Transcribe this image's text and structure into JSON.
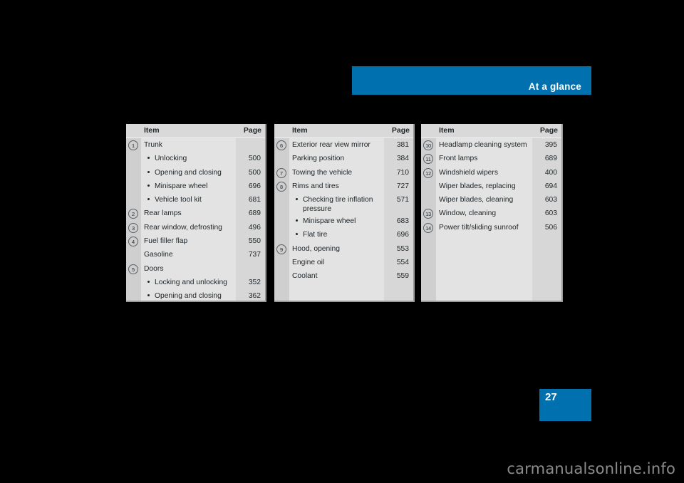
{
  "header": {
    "title": "At a glance",
    "bar_color": "#0070ae"
  },
  "page_number": {
    "value": "27",
    "block_color": "#0070ae"
  },
  "watermark": {
    "text": "carmanualsonline.info",
    "color": "#8c8c8c"
  },
  "columns": {
    "item": "Item",
    "page": "Page"
  },
  "tables": [
    {
      "id": "table-1",
      "rows": [
        {
          "num": "1",
          "label": "Trunk",
          "page": "",
          "type": "main"
        },
        {
          "num": "",
          "label": "Unlocking",
          "page": "500",
          "type": "bullet"
        },
        {
          "num": "",
          "label": "Opening and closing",
          "page": "500",
          "type": "bullet"
        },
        {
          "num": "",
          "label": "Minispare wheel",
          "page": "696",
          "type": "bullet"
        },
        {
          "num": "",
          "label": "Vehicle tool kit",
          "page": "681",
          "type": "bullet"
        },
        {
          "num": "2",
          "label": "Rear lamps",
          "page": "689",
          "type": "main"
        },
        {
          "num": "3",
          "label": "Rear window, defrosting",
          "page": "496",
          "type": "main"
        },
        {
          "num": "4",
          "label": "Fuel filler flap",
          "page": "550",
          "type": "main"
        },
        {
          "num": "",
          "label": "Gasoline",
          "page": "737",
          "type": "plain"
        },
        {
          "num": "5",
          "label": "Doors",
          "page": "",
          "type": "main"
        },
        {
          "num": "",
          "label": "Locking and unlocking",
          "page": "352",
          "type": "bullet"
        },
        {
          "num": "",
          "label": "Opening and closing",
          "page": "362",
          "type": "bullet"
        }
      ]
    },
    {
      "id": "table-2",
      "rows": [
        {
          "num": "6",
          "label": "Exterior rear view mirror",
          "page": "381",
          "type": "main"
        },
        {
          "num": "",
          "label": "Parking position",
          "page": "384",
          "type": "plain"
        },
        {
          "num": "7",
          "label": "Towing the vehicle",
          "page": "710",
          "type": "main"
        },
        {
          "num": "8",
          "label": "Rims and tires",
          "page": "727",
          "type": "main"
        },
        {
          "num": "",
          "label": "Checking tire inflation pressure",
          "page": "571",
          "type": "bullet-tall"
        },
        {
          "num": "",
          "label": "Minispare wheel",
          "page": "683",
          "type": "bullet"
        },
        {
          "num": "",
          "label": "Flat tire",
          "page": "696",
          "type": "bullet"
        },
        {
          "num": "9",
          "label": "Hood, opening",
          "page": "553",
          "type": "main"
        },
        {
          "num": "",
          "label": "Engine oil",
          "page": "554",
          "type": "plain"
        },
        {
          "num": "",
          "label": "Coolant",
          "page": "559",
          "type": "plain"
        }
      ]
    },
    {
      "id": "table-3",
      "rows": [
        {
          "num": "10",
          "label": "Headlamp cleaning system",
          "page": "395",
          "type": "main"
        },
        {
          "num": "11",
          "label": "Front lamps",
          "page": "689",
          "type": "main"
        },
        {
          "num": "12",
          "label": "Windshield wipers",
          "page": "400",
          "type": "main"
        },
        {
          "num": "",
          "label": "Wiper blades, replacing",
          "page": "694",
          "type": "plain"
        },
        {
          "num": "",
          "label": "Wiper blades, cleaning",
          "page": "603",
          "type": "plain"
        },
        {
          "num": "13",
          "label": "Window, cleaning",
          "page": "603",
          "type": "main"
        },
        {
          "num": "14",
          "label": "Power tilt/sliding sunroof",
          "page": "506",
          "type": "main"
        }
      ]
    }
  ]
}
